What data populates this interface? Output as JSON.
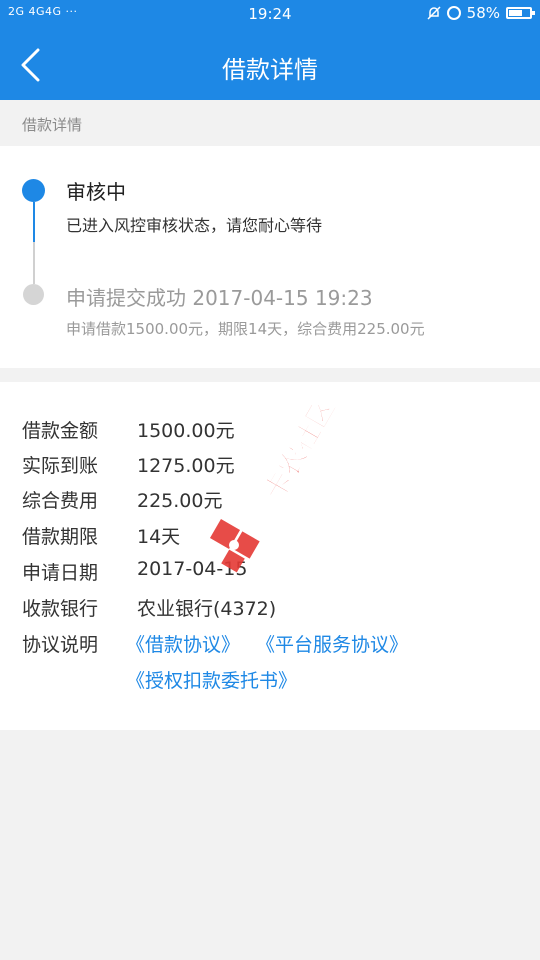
{
  "status_bar": {
    "left_text": "2G 4G4G ···",
    "time": "19:24",
    "battery": "58%",
    "battery_level": 0.58
  },
  "nav": {
    "title": "借款详情"
  },
  "section": {
    "label": "借款详情"
  },
  "timeline": [
    {
      "title": "审核中",
      "desc": "已进入风控审核状态，请您耐心等待"
    },
    {
      "title": "申请提交成功 2017-04-15 19:23",
      "desc": "申请借款1500.00元，期限14天，综合费用225.00元"
    }
  ],
  "details": [
    {
      "label": "借款金额",
      "value": "1500.00元"
    },
    {
      "label": "实际到账",
      "value": "1275.00元"
    },
    {
      "label": "综合费用",
      "value": "225.00元"
    },
    {
      "label": "借款期限",
      "value": "14天"
    },
    {
      "label": "申请日期",
      "value": "2017-04-15"
    },
    {
      "label": "收款银行",
      "value": "农业银行(4372)"
    }
  ],
  "agreement": {
    "label": "协议说明",
    "links": [
      "《借款协议》",
      "《平台服务协议》",
      "《授权扣款委托书》"
    ]
  },
  "watermark_text": "卡农社区",
  "colors": {
    "accent": "#1e88e5",
    "background": "#f2f2f2",
    "watermark": "#e53935"
  }
}
